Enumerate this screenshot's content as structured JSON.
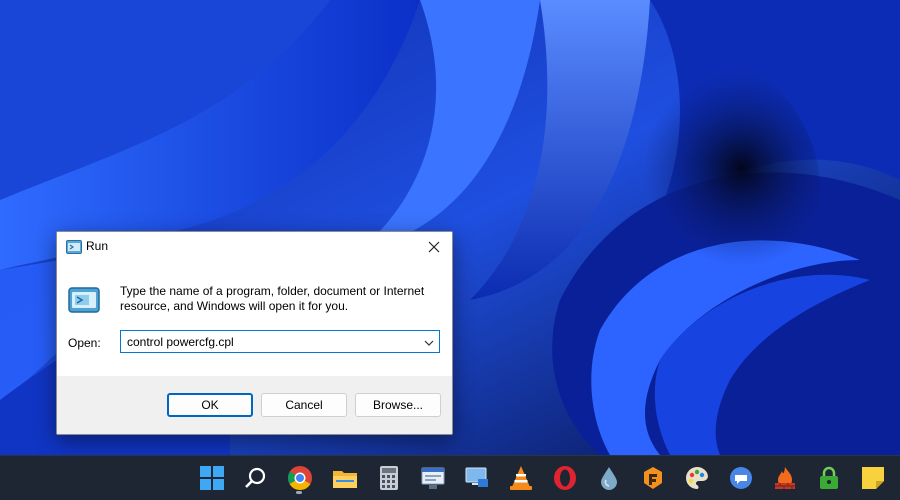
{
  "dialog": {
    "title": "Run",
    "description": "Type the name of a program, folder, document or Internet resource, and Windows will open it for you.",
    "open_label": "Open:",
    "open_value": "control powercfg.cpl",
    "ok_label": "OK",
    "cancel_label": "Cancel",
    "browse_label": "Browse..."
  },
  "taskbar": {
    "icons": [
      "windows-start-icon",
      "search-icon",
      "chrome-icon",
      "file-explorer-icon",
      "calculator-icon",
      "network-window-icon",
      "remote-desktop-icon",
      "vlc-icon",
      "opera-icon",
      "drop-icon",
      "fl-studio-icon",
      "paint-icon",
      "chat-icon",
      "firewall-icon",
      "vpn-lock-icon",
      "sticky-notes-icon"
    ]
  },
  "colors": {
    "accent": "#0067c0",
    "wallpaper_base": "#0a1f6e",
    "taskbar": "#1f2633"
  }
}
